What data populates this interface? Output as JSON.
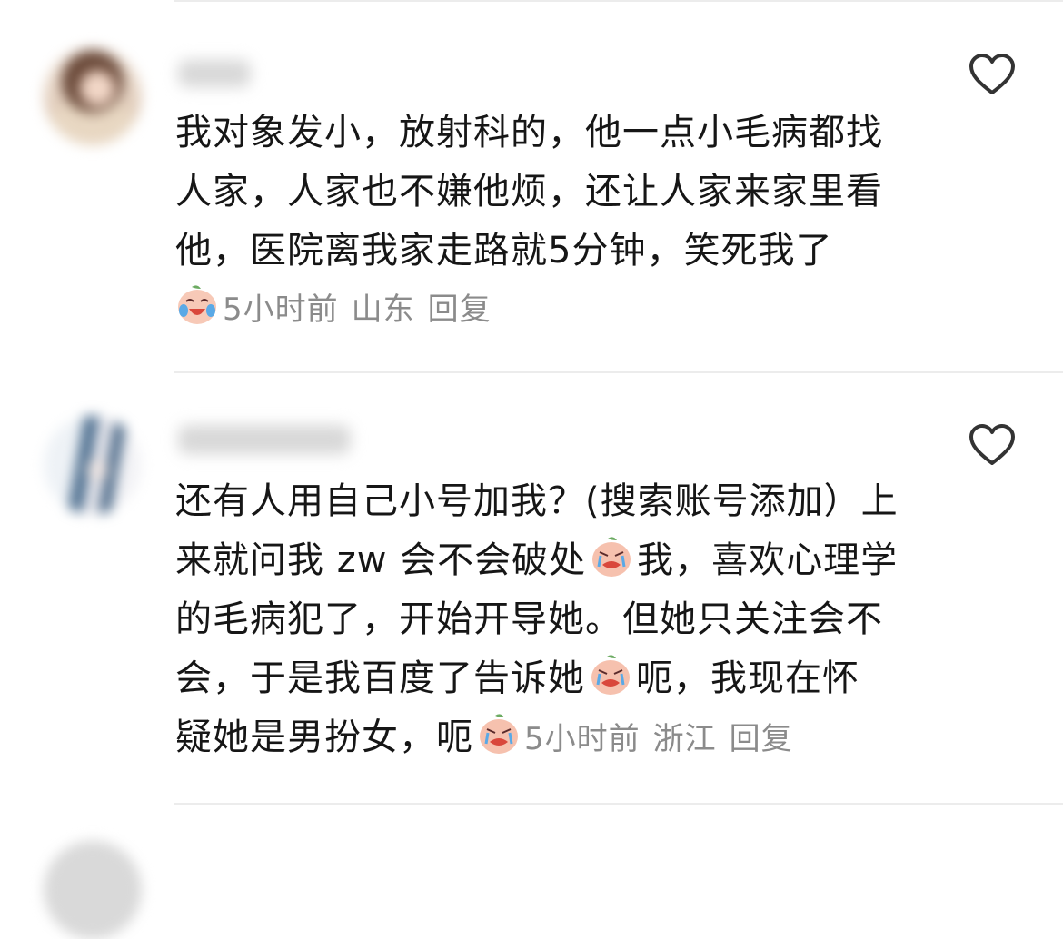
{
  "comments": [
    {
      "text_lines": [
        "我对象发小，放射科的，他一点小毛病都找",
        "人家，人家也不嫌他烦，还让人家来家里看",
        "他，医院离我家走路就5分钟，笑死我了"
      ],
      "time": "5小时前",
      "location": "山东",
      "reply_label": "回复"
    },
    {
      "text_lines": [
        "还有人用自己小号加我？(搜索账号添加）上",
        "来就问我 zw 会不会破处",
        "我，喜欢心理学",
        "的毛病犯了，开始开导她。但她只关注会不",
        "会，于是我百度了告诉她",
        "呃，我现在怀",
        "疑她是男扮女，呃"
      ],
      "time": "5小时前",
      "location": "浙江",
      "reply_label": "回复"
    }
  ],
  "icons": {
    "like": "heart-outline-icon",
    "emoji_laugh": "laughing-crying-emoji",
    "emoji_cry": "crying-emoji"
  },
  "colors": {
    "text": "#161616",
    "meta": "#8b8b8b",
    "divider": "#ececec",
    "heart": "#333333"
  }
}
